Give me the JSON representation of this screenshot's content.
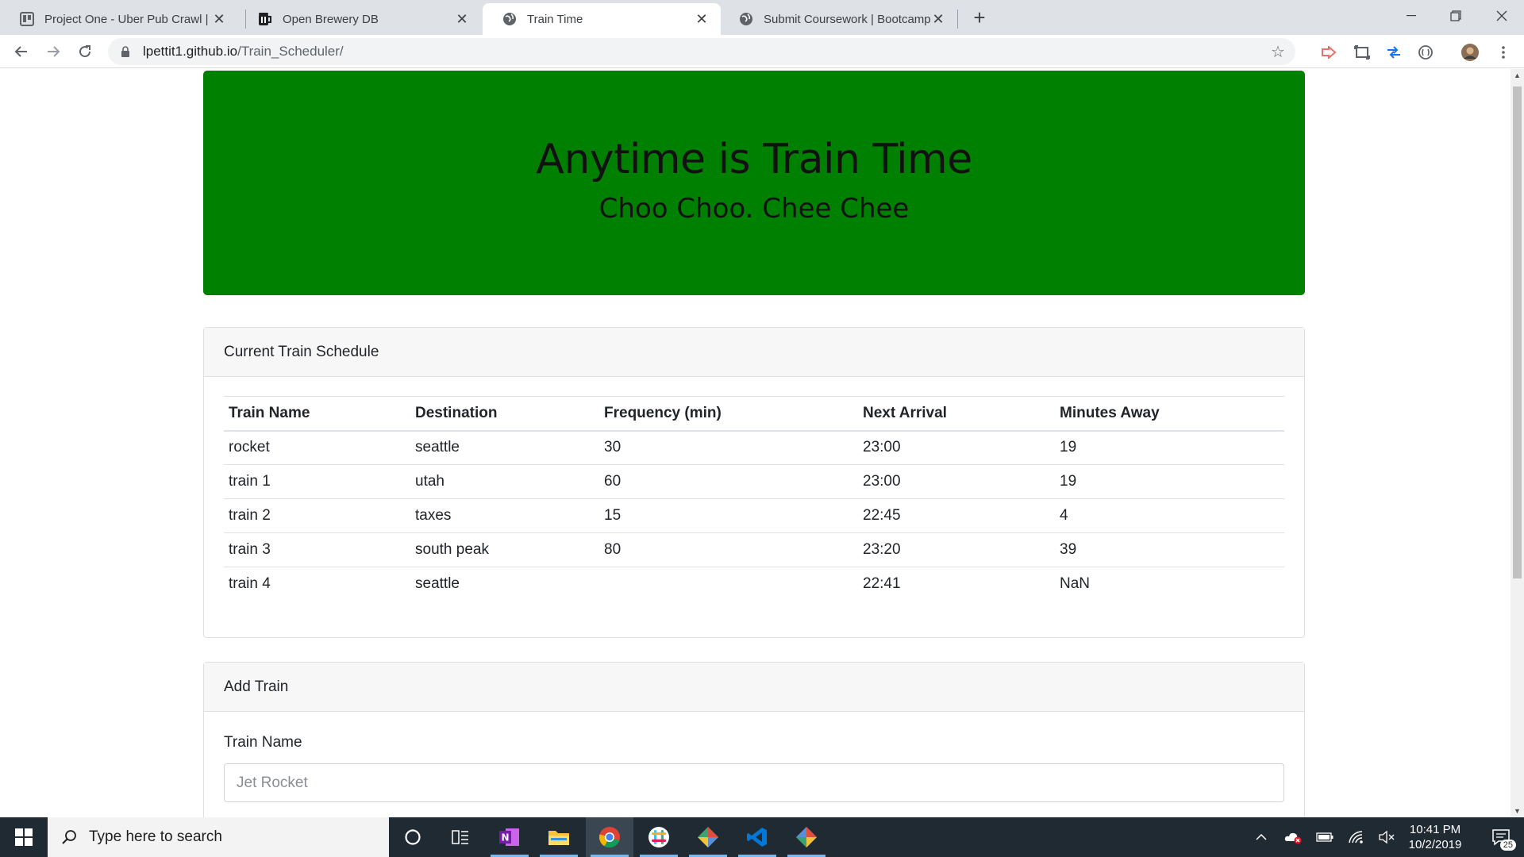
{
  "browser": {
    "tabs": [
      {
        "title": "Project One - Uber Pub Crawl | Tr",
        "icon": "trello-icon"
      },
      {
        "title": "Open Brewery DB",
        "icon": "brewery-icon"
      },
      {
        "title": "Train Time",
        "icon": "globe-icon"
      },
      {
        "title": "Submit Coursework | Bootcamp S",
        "icon": "globe-icon"
      }
    ],
    "url_host": "lpettit1.github.io",
    "url_path": "/Train_Scheduler/"
  },
  "page": {
    "title": "Anytime is Train Time",
    "subtitle": "Choo Choo. Chee Chee",
    "accent_color": "#008000",
    "schedule": {
      "header": "Current Train Schedule",
      "columns": [
        "Train Name",
        "Destination",
        "Frequency (min)",
        "Next Arrival",
        "Minutes Away"
      ],
      "rows": [
        [
          "rocket",
          "seattle",
          "30",
          "23:00",
          "19"
        ],
        [
          "train 1",
          "utah",
          "60",
          "23:00",
          "19"
        ],
        [
          "train 2",
          "taxes",
          "15",
          "22:45",
          "4"
        ],
        [
          "train 3",
          "south peak",
          "80",
          "23:20",
          "39"
        ],
        [
          "train 4",
          "seattle",
          "",
          "22:41",
          "NaN"
        ]
      ]
    },
    "add_train": {
      "header": "Add Train",
      "train_name_label": "Train Name",
      "train_name_placeholder": "Jet Rocket"
    }
  },
  "taskbar": {
    "search_placeholder": "Type here to search",
    "time": "10:41 PM",
    "date": "10/2/2019",
    "notification_count": "25"
  }
}
